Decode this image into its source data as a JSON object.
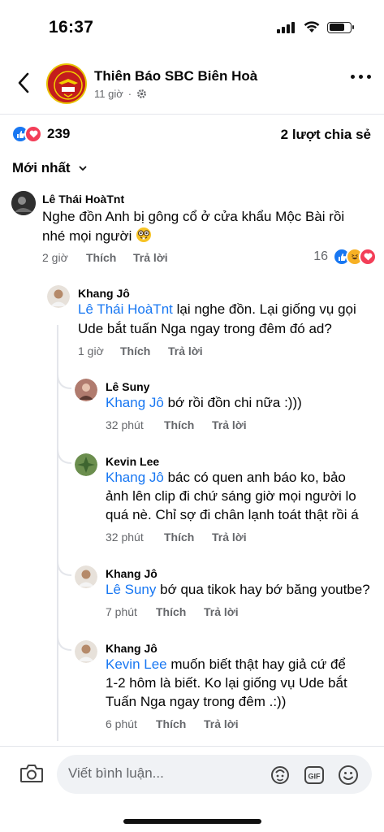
{
  "status_bar": {
    "time": "16:37"
  },
  "header": {
    "page_name": "Thiên Báo SBC Biên Hoà",
    "time": "11 giờ"
  },
  "reactions": {
    "count": "239",
    "shares": "2 lượt chia sẻ"
  },
  "sort": {
    "label": "Mới nhất"
  },
  "comments": {
    "c1": {
      "author": "Lê Thái HoàTnt",
      "line1": "Nghe đồn Anh bị gông cổ ở cửa khẩu Mộc Bài rồi",
      "line2": "nhé mọi người",
      "time": "2 giờ",
      "like": "Thích",
      "reply": "Trả lời",
      "reaction_count": "16"
    },
    "c2": {
      "author": "Khang Jô",
      "mention": "Lê Thái HoàTnt",
      "line1": " lại nghe đồn. Lại giống vụ gọi",
      "line2": "Ude bắt tuấn Nga ngay trong đêm đó ad?",
      "time": "1 giờ",
      "like": "Thích",
      "reply": "Trả lời"
    },
    "c3": {
      "author": "Lê Suny",
      "mention": "Khang Jô",
      "line1": " bớ rồi đồn chi nữa :)))",
      "time": "32 phút",
      "like": "Thích",
      "reply": "Trả lời"
    },
    "c4": {
      "author": "Kevin Lee",
      "mention": "Khang Jô",
      "line1": " bác có quen anh báo ko, bảo",
      "line2": "ảnh lên clip đi chứ sáng giờ mọi người lo",
      "line3": "quá nè. Chỉ sợ đi chân lạnh toát thật rồi á",
      "time": "32 phút",
      "like": "Thích",
      "reply": "Trả lời"
    },
    "c5": {
      "author": "Khang Jô",
      "mention": "Lê Suny",
      "line1": " bớ qua tikok hay bớ băng youtbe?",
      "time": "7 phút",
      "like": "Thích",
      "reply": "Trả lời"
    },
    "c6": {
      "author": "Khang Jô",
      "mention": "Kevin Lee",
      "line1": " muốn biết thật hay giả cứ để",
      "line2": "1-2 hôm là biết. Ko lại giống vụ Ude bắt",
      "line3": "Tuấn Nga ngay trong đêm .:))",
      "time": "6 phút",
      "like": "Thích",
      "reply": "Trả lời"
    }
  },
  "input": {
    "placeholder": "Viết bình luận..."
  },
  "colors": {
    "accent": "#1877f2",
    "secondary_text": "#65676b",
    "love": "#f33e58",
    "haha": "#f7b125"
  }
}
